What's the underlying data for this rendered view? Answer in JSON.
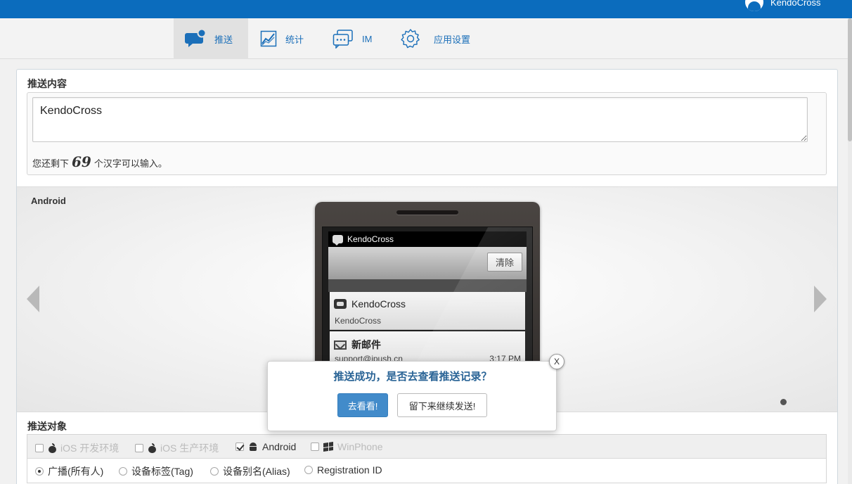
{
  "header": {
    "user_name": "KendoCross"
  },
  "nav": {
    "items": [
      {
        "label": "推送",
        "icon": "chat-bubble-icon",
        "active": true
      },
      {
        "label": "统计",
        "icon": "chart-icon"
      },
      {
        "label": "IM",
        "icon": "im-chat-icon"
      },
      {
        "label": "应用设置",
        "icon": "gear-icon"
      }
    ]
  },
  "content": {
    "title": "推送内容",
    "message": "KendoCross",
    "remaining_prefix": "您还剩下",
    "remaining_count": "69",
    "remaining_suffix": "个汉字可以输入。"
  },
  "preview": {
    "platform_label": "Android",
    "status_title": "KendoCross",
    "clear_label": "清除",
    "notif1_title": "KendoCross",
    "notif1_body": "KendoCross",
    "notif2_title": "新邮件",
    "notif2_sender": "support@jpush.cn",
    "notif2_time": "3:17 PM"
  },
  "targets": {
    "title": "推送对象",
    "platforms": [
      {
        "label": "iOS 开发环境",
        "checked": false,
        "disabled": true
      },
      {
        "label": "iOS 生产环境",
        "checked": false,
        "disabled": true
      },
      {
        "label": "Android",
        "checked": true,
        "disabled": false
      },
      {
        "label": "WinPhone",
        "checked": false,
        "disabled": true
      }
    ],
    "audience": [
      {
        "label": "广播(所有人)",
        "checked": true
      },
      {
        "label": "设备标签(Tag)",
        "checked": false
      },
      {
        "label": "设备别名(Alias)",
        "checked": false
      },
      {
        "label": "Registration ID",
        "checked": false
      }
    ]
  },
  "modal": {
    "message": "推送成功，是否去查看推送记录？",
    "close_label": "X",
    "confirm_label": "去看看!",
    "stay_label": "留下来继续发送!"
  },
  "colors": {
    "brand": "#0b6cbd",
    "link": "#1b6fb9",
    "primary_button": "#428bca"
  }
}
